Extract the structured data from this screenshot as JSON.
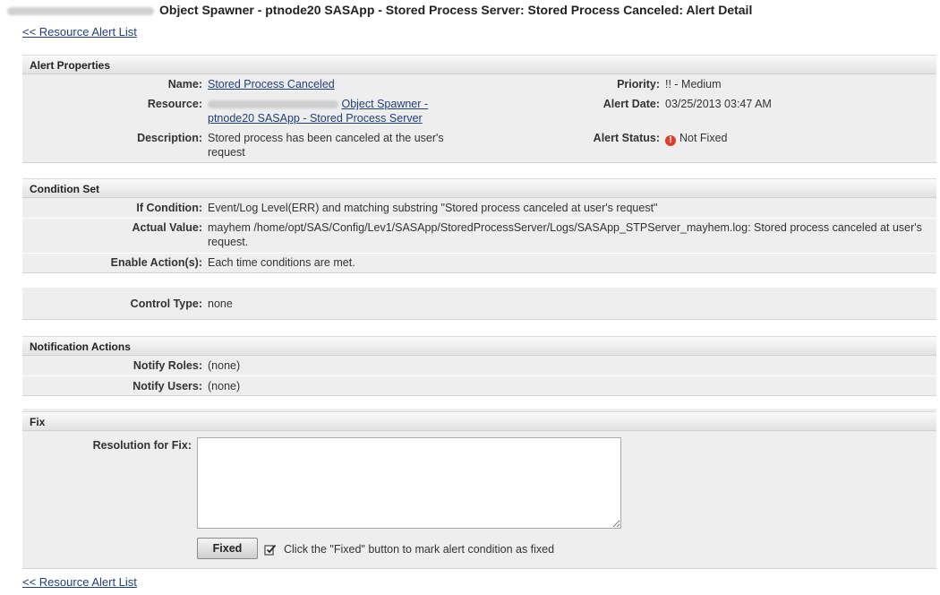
{
  "page": {
    "title": "Object Spawner - ptnode20 SASApp - Stored Process Server: Stored Process Canceled: Alert Detail"
  },
  "nav": {
    "back_link_top": "<< Resource Alert List",
    "back_link_bottom": "<< Resource Alert List"
  },
  "alert_properties": {
    "heading": "Alert Properties",
    "name_label": "Name:",
    "name_value": "Stored Process Canceled",
    "resource_label": "Resource:",
    "resource_value_line1": "Object Spawner -",
    "resource_value_line2": "ptnode20 SASApp - Stored Process Server",
    "description_label": "Description:",
    "description_value": "Stored process has been canceled at the user's request",
    "priority_label": "Priority:",
    "priority_value": "!! - Medium",
    "alert_date_label": "Alert Date:",
    "alert_date_value": "03/25/2013 03:47 AM",
    "alert_status_label": "Alert Status:",
    "alert_status_value": "Not Fixed",
    "alert_status_icon": "alert-error-icon",
    "alert_status_icon_glyph": "!",
    "alert_status_color": "#d8412f"
  },
  "condition_set": {
    "heading": "Condition Set",
    "if_condition_label": "If Condition:",
    "if_condition_value": "Event/Log Level(ERR) and matching substring \"Stored process canceled at user's request\"",
    "actual_value_label": "Actual Value:",
    "actual_value_value": "mayhem /home/opt/SAS/Config/Lev1/SASApp/StoredProcessServer/Logs/SASApp_STPServer_mayhem.log: Stored process canceled at user's request.",
    "enable_actions_label": "Enable Action(s):",
    "enable_actions_value": "Each time conditions are met."
  },
  "control": {
    "control_type_label": "Control Type:",
    "control_type_value": "none"
  },
  "notification_actions": {
    "heading": "Notification Actions",
    "notify_roles_label": "Notify Roles:",
    "notify_roles_value": "(none)",
    "notify_users_label": "Notify Users:",
    "notify_users_value": "(none)"
  },
  "fix": {
    "heading": "Fix",
    "resolution_label": "Resolution for Fix:",
    "resolution_value": "",
    "fixed_button_label": "Fixed",
    "hint_icon": "checkbox-check-icon",
    "hint_text": "Click the \"Fixed\" button to mark alert condition as fixed"
  },
  "colors": {
    "link": "#1f3f7a",
    "panel_background": "#eeeeee",
    "header_gradient": "#e2e2e2"
  }
}
